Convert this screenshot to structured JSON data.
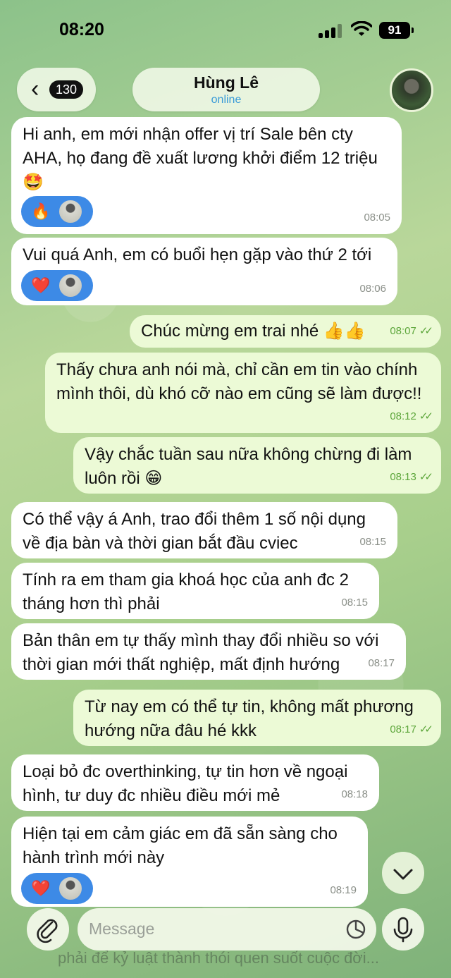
{
  "status_bar": {
    "time": "08:20",
    "battery": "91"
  },
  "header": {
    "back_count": "130",
    "contact_name": "Hùng Lê",
    "contact_status": "online"
  },
  "messages": [
    {
      "direction": "in",
      "text": "Hi anh, em mới nhận offer vị trí Sale bên cty AHA, họ đang đề xuất lương khởi điểm 12 triệu 🤩",
      "time": "08:05",
      "reaction": "🔥"
    },
    {
      "direction": "in",
      "text": "Vui quá Anh, em có buổi hẹn gặp vào thứ 2 tới",
      "time": "08:06",
      "reaction": "❤️"
    },
    {
      "direction": "out",
      "text": "Chúc mừng em trai nhé 👍👍",
      "time": "08:07",
      "read": "✓✓"
    },
    {
      "direction": "out",
      "text": "Thấy chưa anh nói mà, chỉ cần em tin vào chính mình thôi, dù khó cỡ nào em cũng sẽ làm được!!",
      "time": "08:12",
      "read": "✓✓"
    },
    {
      "direction": "out",
      "text": "Vậy chắc tuần sau nữa không chừng đi làm luôn rồi 😁",
      "time": "08:13",
      "read": "✓✓"
    },
    {
      "direction": "in",
      "text": "Có thể vậy á Anh, trao đổi thêm 1 số nội dụng về địa bàn và thời gian bắt đầu cviec",
      "time": "08:15"
    },
    {
      "direction": "in",
      "text": "Tính ra em tham gia khoá học của anh đc 2 tháng hơn thì phải",
      "time": "08:15"
    },
    {
      "direction": "in",
      "text": "Bản thân em tự thấy mình thay đổi nhiều so với thời gian mới thất nghiệp, mất định hướng",
      "time": "08:17"
    },
    {
      "direction": "out",
      "text": "Từ nay em có thể tự tin, không mất phương hướng nữa đâu hé kkk",
      "time": "08:17",
      "read": "✓✓"
    },
    {
      "direction": "in",
      "text": "Loại bỏ đc overthinking, tự tin hơn về ngoại hình, tư duy đc nhiều điều mới mẻ",
      "time": "08:18"
    },
    {
      "direction": "in",
      "text": "Hiện tại em cảm giác em đã sẵn sàng cho hành trình mới này",
      "time": "08:19",
      "reaction": "❤️"
    }
  ],
  "composer": {
    "placeholder": "Message",
    "preview_text": "phải để kỷ luật thành thói quen suốt cuộc đời..."
  },
  "icons": {
    "back": "chevron-left-icon",
    "attach": "paperclip-icon",
    "sticker": "sticker-icon",
    "mic": "microphone-icon",
    "scroll": "chevron-down-icon"
  },
  "colors": {
    "incoming_bubble": "#ffffff",
    "outgoing_bubble": "#ecfad6",
    "reaction_bg": "#3d8ae6",
    "online": "#3a9bd8",
    "read_ticks": "#5da63b"
  }
}
